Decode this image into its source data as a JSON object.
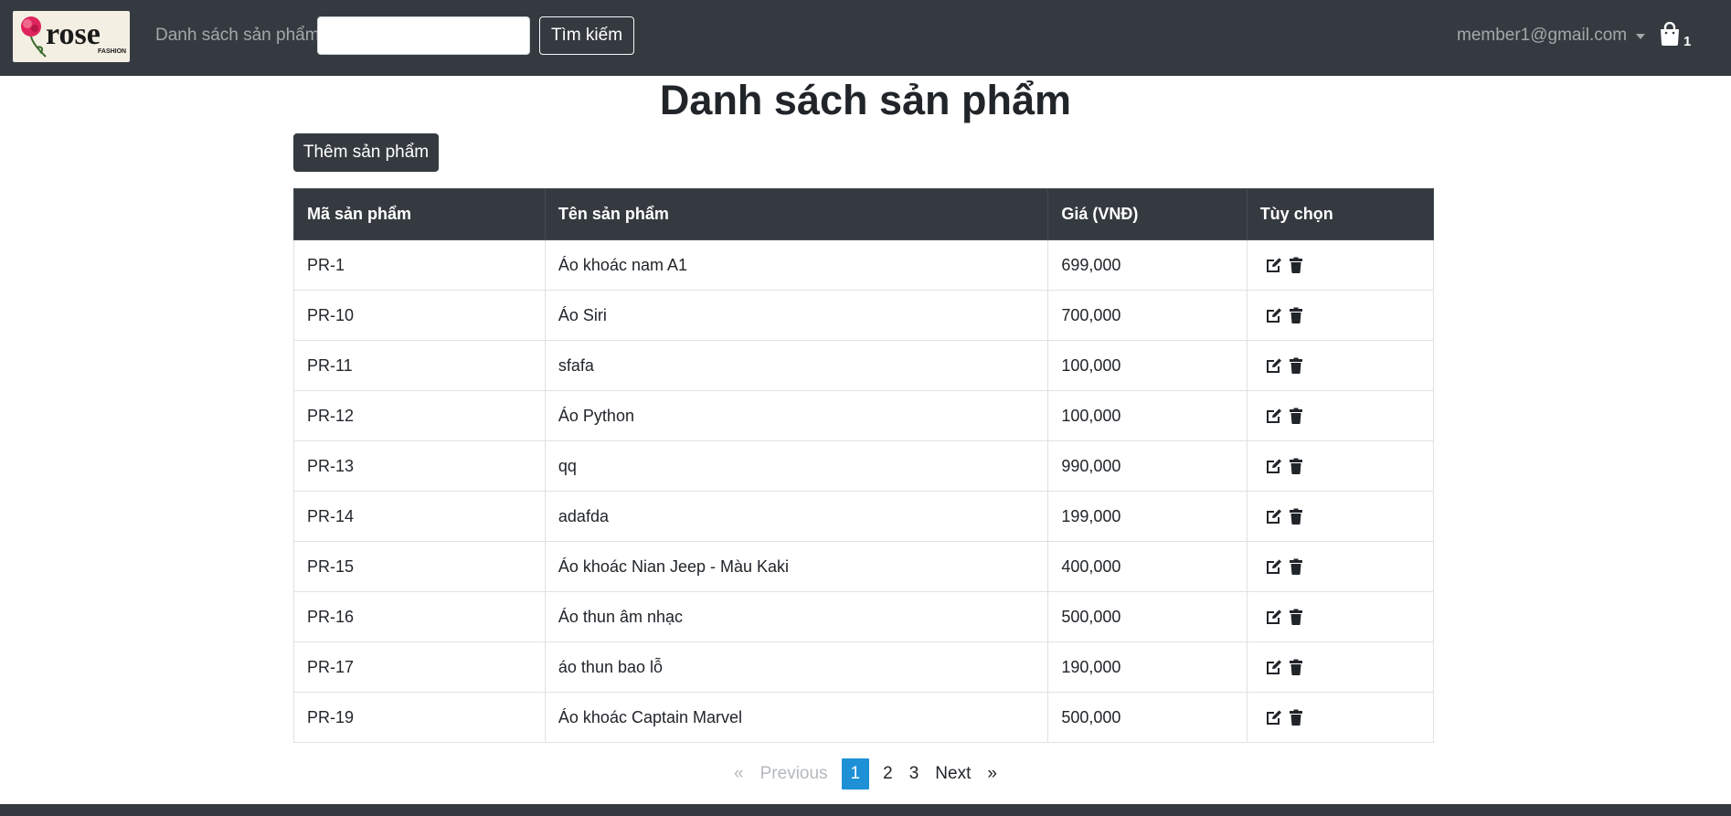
{
  "navbar": {
    "logo_text": "rose",
    "logo_subtext": "FASHION",
    "nav_link": "Danh sách sản phẩm",
    "search_value": "",
    "search_placeholder": "",
    "search_button": "Tìm kiếm",
    "user_email": "member1@gmail.com",
    "cart_count": "1"
  },
  "page": {
    "title": "Danh sách sản phẩm",
    "add_button": "Thêm sản phẩm"
  },
  "table": {
    "headers": [
      "Mã sản phẩm",
      "Tên sản phẩm",
      "Giá (VNĐ)",
      "Tùy chọn"
    ],
    "rows": [
      {
        "code": "PR-1",
        "name": "Áo khoác nam A1",
        "price": "699,000"
      },
      {
        "code": "PR-10",
        "name": "Áo Siri",
        "price": "700,000"
      },
      {
        "code": "PR-11",
        "name": "sfafa",
        "price": "100,000"
      },
      {
        "code": "PR-12",
        "name": "Áo Python",
        "price": "100,000"
      },
      {
        "code": "PR-13",
        "name": "qq",
        "price": "990,000"
      },
      {
        "code": "PR-14",
        "name": "adafda",
        "price": "199,000"
      },
      {
        "code": "PR-15",
        "name": "Áo khoác Nian Jeep - Màu Kaki",
        "price": "400,000"
      },
      {
        "code": "PR-16",
        "name": "Áo thun âm nhạc",
        "price": "500,000"
      },
      {
        "code": "PR-17",
        "name": "áo thun bao lỗ",
        "price": "190,000"
      },
      {
        "code": "PR-19",
        "name": "Áo khoác Captain Marvel",
        "price": "500,000"
      }
    ],
    "row_icons": [
      "edit-icon",
      "trash-icon"
    ]
  },
  "pagination": {
    "prev_symbol": "«",
    "prev_label": "Previous",
    "pages": [
      "1",
      "2",
      "3"
    ],
    "active_page": "1",
    "next_label": "Next",
    "next_symbol": "»"
  },
  "colors": {
    "navbar": "#343a40",
    "active_page": "#1e90d6",
    "logo_rose": "#e0245e"
  }
}
